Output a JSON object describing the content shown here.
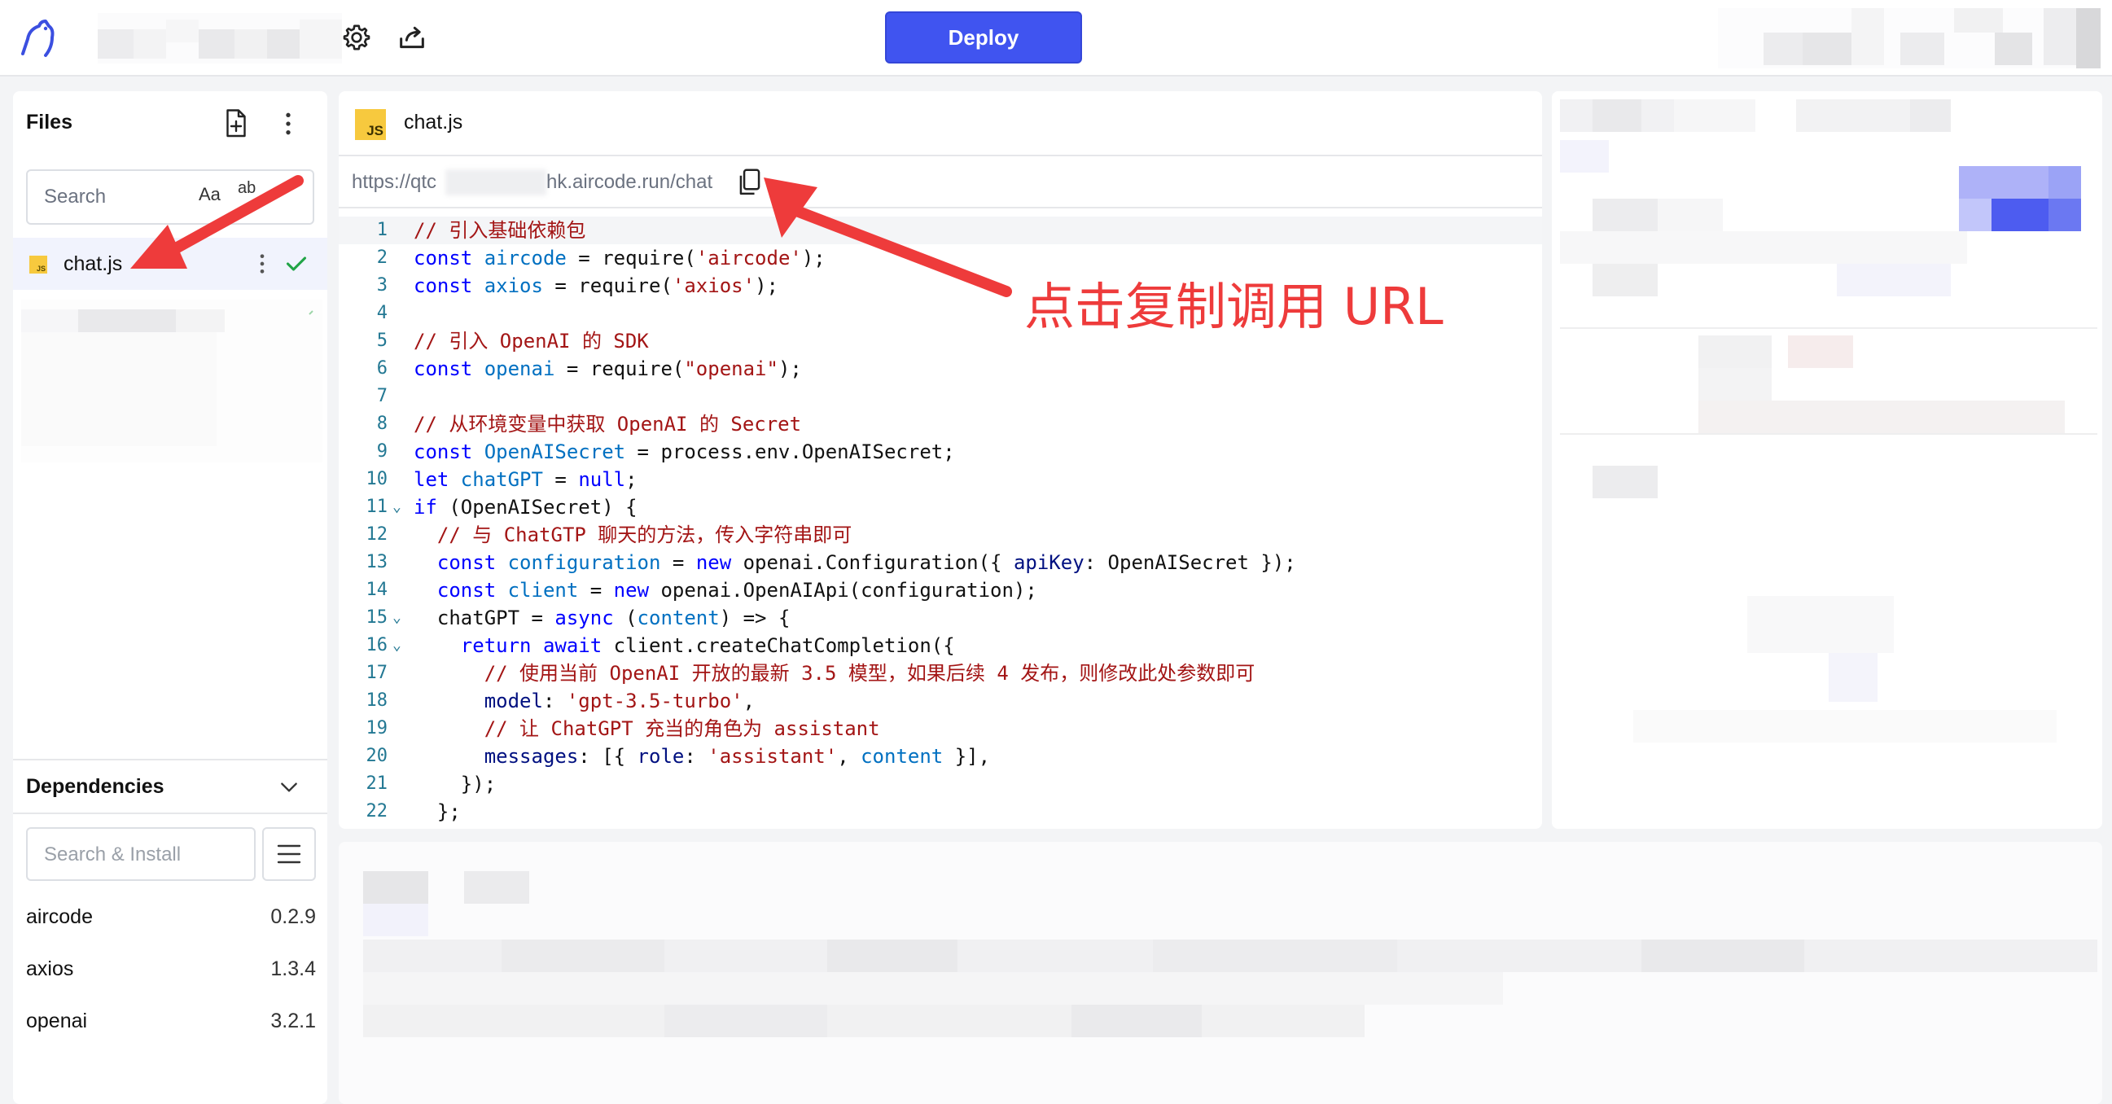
{
  "topbar": {
    "deploy_label": "Deploy",
    "settings_icon": "gear-icon",
    "share_icon": "share-icon",
    "logo_icon": "squirrel-logo-icon",
    "accent_color": "#4054f0"
  },
  "files": {
    "title": "Files",
    "search_placeholder": "Search",
    "match_case_label": "Aa",
    "match_word_label": "ab",
    "items": [
      {
        "name": "chat.js",
        "status": "saved"
      }
    ]
  },
  "dependencies": {
    "title": "Dependencies",
    "search_placeholder": "Search & Install",
    "items": [
      {
        "name": "aircode",
        "version": "0.2.9"
      },
      {
        "name": "axios",
        "version": "1.3.4"
      },
      {
        "name": "openai",
        "version": "3.2.1"
      }
    ]
  },
  "editor": {
    "tab_name": "chat.js",
    "js_badge": "JS",
    "url_prefix": "https://qtc",
    "url_suffix": "hk.aircode.run/chat",
    "lines": [
      {
        "n": "1",
        "fold": "",
        "active": true,
        "tokens": [
          [
            "cm",
            "// 引入基础依赖包"
          ]
        ]
      },
      {
        "n": "2",
        "fold": "",
        "tokens": [
          [
            "kw",
            "const "
          ],
          [
            "var",
            "aircode"
          ],
          [
            "pl",
            " = require("
          ],
          [
            "str",
            "'aircode'"
          ],
          [
            "pl",
            ");"
          ]
        ]
      },
      {
        "n": "3",
        "fold": "",
        "tokens": [
          [
            "kw",
            "const "
          ],
          [
            "var",
            "axios"
          ],
          [
            "pl",
            " = require("
          ],
          [
            "str",
            "'axios'"
          ],
          [
            "pl",
            ");"
          ]
        ]
      },
      {
        "n": "4",
        "fold": "",
        "tokens": []
      },
      {
        "n": "5",
        "fold": "",
        "tokens": [
          [
            "cm",
            "// 引入 OpenAI 的 SDK"
          ]
        ]
      },
      {
        "n": "6",
        "fold": "",
        "tokens": [
          [
            "kw",
            "const "
          ],
          [
            "var",
            "openai"
          ],
          [
            "pl",
            " = require("
          ],
          [
            "str",
            "\"openai\""
          ],
          [
            "pl",
            ");"
          ]
        ]
      },
      {
        "n": "7",
        "fold": "",
        "tokens": []
      },
      {
        "n": "8",
        "fold": "",
        "tokens": [
          [
            "cm",
            "// 从环境变量中获取 OpenAI 的 Secret"
          ]
        ]
      },
      {
        "n": "9",
        "fold": "",
        "tokens": [
          [
            "kw",
            "const "
          ],
          [
            "var",
            "OpenAISecret"
          ],
          [
            "pl",
            " = process.env.OpenAISecret;"
          ]
        ]
      },
      {
        "n": "10",
        "fold": "",
        "tokens": [
          [
            "kw",
            "let "
          ],
          [
            "var",
            "chatGPT"
          ],
          [
            "pl",
            " = "
          ],
          [
            "kw",
            "null"
          ],
          [
            "pl",
            ";"
          ]
        ]
      },
      {
        "n": "11",
        "fold": "⌄",
        "tokens": [
          [
            "kw",
            "if "
          ],
          [
            "pl",
            "(OpenAISecret) {"
          ]
        ]
      },
      {
        "n": "12",
        "fold": "",
        "tokens": [
          [
            "pl",
            "  "
          ],
          [
            "cm",
            "// 与 ChatGTP 聊天的方法，传入字符串即可"
          ]
        ]
      },
      {
        "n": "13",
        "fold": "",
        "tokens": [
          [
            "pl",
            "  "
          ],
          [
            "kw",
            "const "
          ],
          [
            "var",
            "configuration"
          ],
          [
            "pl",
            " = "
          ],
          [
            "kw",
            "new "
          ],
          [
            "pl",
            "openai.Configuration({ "
          ],
          [
            "prop",
            "apiKey"
          ],
          [
            "pl",
            ": OpenAISecret });"
          ]
        ]
      },
      {
        "n": "14",
        "fold": "",
        "tokens": [
          [
            "pl",
            "  "
          ],
          [
            "kw",
            "const "
          ],
          [
            "var",
            "client"
          ],
          [
            "pl",
            " = "
          ],
          [
            "kw",
            "new "
          ],
          [
            "pl",
            "openai.OpenAIApi(configuration);"
          ]
        ]
      },
      {
        "n": "15",
        "fold": "⌄",
        "tokens": [
          [
            "pl",
            "  chatGPT = "
          ],
          [
            "kw",
            "async "
          ],
          [
            "pl",
            "("
          ],
          [
            "var",
            "content"
          ],
          [
            "pl",
            ") => {"
          ]
        ]
      },
      {
        "n": "16",
        "fold": "⌄",
        "tokens": [
          [
            "pl",
            "    "
          ],
          [
            "kw",
            "return await "
          ],
          [
            "pl",
            "client.createChatCompletion({"
          ]
        ]
      },
      {
        "n": "17",
        "fold": "",
        "tokens": [
          [
            "pl",
            "      "
          ],
          [
            "cm",
            "// 使用当前 OpenAI 开放的最新 3.5 模型，如果后续 4 发布，则修改此处参数即可"
          ]
        ]
      },
      {
        "n": "18",
        "fold": "",
        "tokens": [
          [
            "pl",
            "      "
          ],
          [
            "prop",
            "model"
          ],
          [
            "pl",
            ": "
          ],
          [
            "str",
            "'gpt-3.5-turbo'"
          ],
          [
            "pl",
            ","
          ]
        ]
      },
      {
        "n": "19",
        "fold": "",
        "tokens": [
          [
            "pl",
            "      "
          ],
          [
            "cm",
            "// 让 ChatGPT 充当的角色为 assistant"
          ]
        ]
      },
      {
        "n": "20",
        "fold": "",
        "tokens": [
          [
            "pl",
            "      "
          ],
          [
            "prop",
            "messages"
          ],
          [
            "pl",
            ": [{ "
          ],
          [
            "prop",
            "role"
          ],
          [
            "pl",
            ": "
          ],
          [
            "str",
            "'assistant'"
          ],
          [
            "pl",
            ", "
          ],
          [
            "var",
            "content"
          ],
          [
            "pl",
            " }],"
          ]
        ]
      },
      {
        "n": "21",
        "fold": "",
        "tokens": [
          [
            "pl",
            "    });"
          ]
        ]
      },
      {
        "n": "22",
        "fold": "",
        "tokens": [
          [
            "pl",
            "  };"
          ]
        ]
      }
    ]
  },
  "annotation": {
    "text": "点击复制调用 URL",
    "color": "#ee3b3b"
  }
}
